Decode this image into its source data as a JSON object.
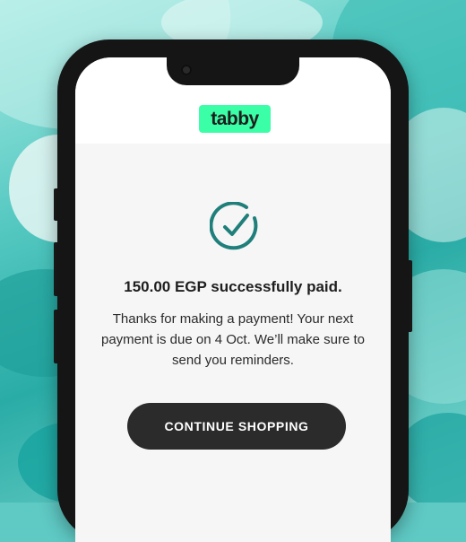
{
  "brand": {
    "logo_text": "tabby",
    "logo_color": "#3bffa6"
  },
  "confirmation": {
    "icon": "check-circle-icon",
    "icon_color": "#1f7f7a",
    "headline": "150.00 EGP successfully paid.",
    "message": "Thanks for making a payment! Your next payment is due on 4 Oct. We’ll make sure to send you reminders."
  },
  "actions": {
    "continue_label": "CONTINUE SHOPPING"
  }
}
